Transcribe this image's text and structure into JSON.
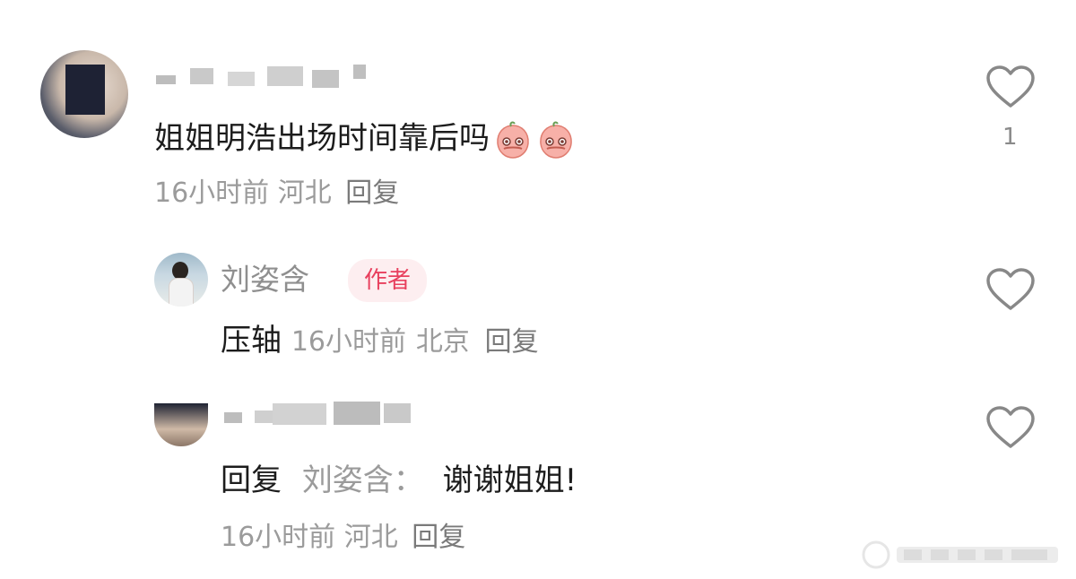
{
  "comments": [
    {
      "text": "姐姐明浩出场时间靠后吗",
      "emoji": "peach-face-emoji",
      "time": "16小时前",
      "location": "河北",
      "reply_label": "回复",
      "likes": "1"
    }
  ],
  "author_reply": {
    "name": "刘姿含",
    "badge": "作者",
    "text": "压轴",
    "time": "16小时前",
    "location": "北京",
    "reply_label": "回复"
  },
  "sub_reply": {
    "prefix": "回复",
    "target": "刘姿含：",
    "text": "谢谢姐姐!",
    "time": "16小时前",
    "location": "河北",
    "reply_label": "回复"
  },
  "colors": {
    "badge_bg": "#fdeef0",
    "badge_text": "#e8405e",
    "meta_gray": "#9b9b9b"
  },
  "icons": [
    "heart-outline-icon",
    "peach-face-emoji"
  ]
}
